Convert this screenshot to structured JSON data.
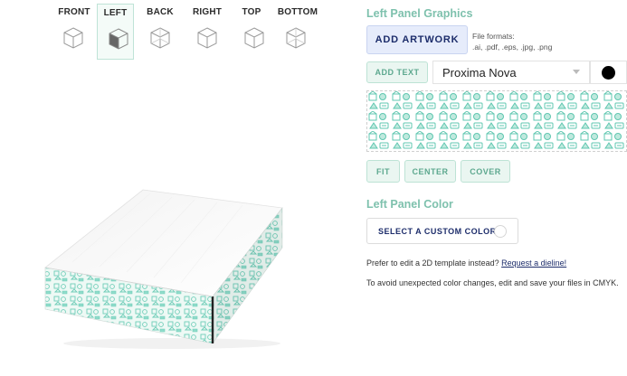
{
  "views": [
    {
      "label": "FRONT",
      "icon": "cube-front-icon",
      "active": false
    },
    {
      "label": "LEFT",
      "icon": "cube-left-icon",
      "active": true
    },
    {
      "label": "BACK",
      "icon": "cube-back-icon",
      "active": false
    },
    {
      "label": "RIGHT",
      "icon": "cube-right-icon",
      "active": false
    },
    {
      "label": "TOP",
      "icon": "cube-top-icon",
      "active": false
    },
    {
      "label": "BOTTOM",
      "icon": "cube-bottom-icon",
      "active": false
    }
  ],
  "graphics": {
    "title": "Left Panel Graphics",
    "add_artwork": "ADD ARTWORK",
    "formats_line1": "File formats:",
    "formats_line2": ".ai, .pdf, .eps, .jpg, .png",
    "add_text": "ADD TEXT",
    "font": "Proxima Nova",
    "text_color": "#000000",
    "fit": "FIT",
    "center": "CENTER",
    "cover": "COVER"
  },
  "color": {
    "title": "Left Panel Color",
    "select_custom": "SELECT A CUSTOM COLOR"
  },
  "notes": {
    "dieline_prefix": "Prefer to edit a 2D template instead?",
    "dieline_link": "Request a dieline!",
    "cmyk": "To avoid unexpected color changes, edit and save your files in CMYK."
  },
  "colors": {
    "accent": "#7ec1ad",
    "pattern": "#6fcdb8",
    "navy": "#1d2d6b"
  }
}
